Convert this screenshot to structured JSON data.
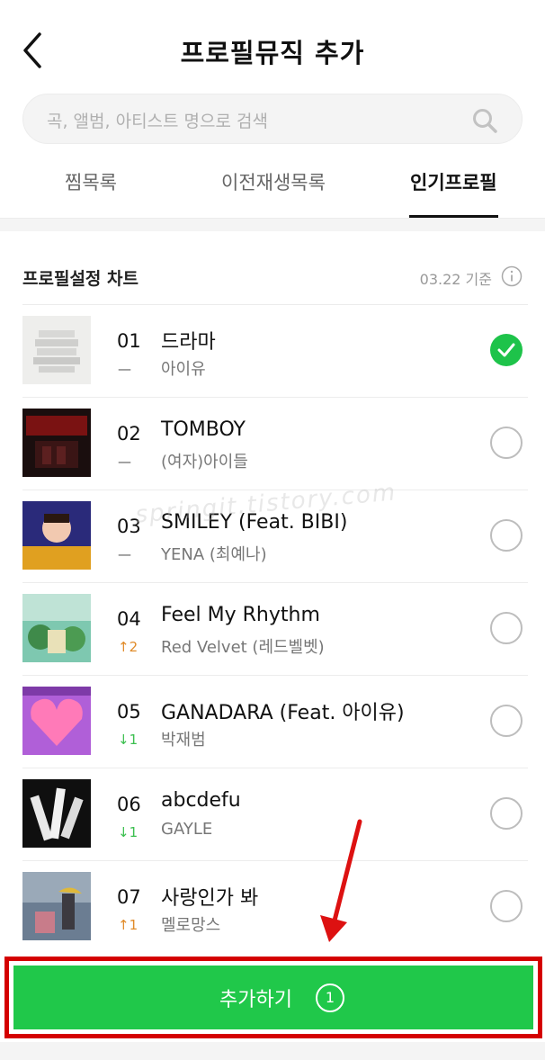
{
  "header": {
    "title": "프로필뮤직 추가",
    "back_icon": "chevron-left-icon"
  },
  "search": {
    "placeholder": "곡, 앨범, 아티스트 명으로 검색",
    "icon": "search-icon"
  },
  "tabs": [
    {
      "label": "찜목록",
      "active": false
    },
    {
      "label": "이전재생목록",
      "active": false
    },
    {
      "label": "인기프로필",
      "active": true
    }
  ],
  "section": {
    "title": "프로필설정 차트",
    "date": "03.22 기준",
    "info_icon": "info-icon"
  },
  "chart": [
    {
      "rank": "01",
      "change": "—",
      "change_type": "same",
      "title": "드라마",
      "artist": "아이유",
      "selected": true
    },
    {
      "rank": "02",
      "change": "—",
      "change_type": "same",
      "title": "TOMBOY",
      "artist": "(여자)아이들",
      "selected": false
    },
    {
      "rank": "03",
      "change": "—",
      "change_type": "same",
      "title": "SMILEY (Feat. BIBI)",
      "artist": "YENA (최예나)",
      "selected": false
    },
    {
      "rank": "04",
      "change": "↑2",
      "change_type": "up",
      "title": "Feel My Rhythm",
      "artist": "Red Velvet (레드벨벳)",
      "selected": false
    },
    {
      "rank": "05",
      "change": "↓1",
      "change_type": "down",
      "title": "GANADARA (Feat. 아이유)",
      "artist": "박재범",
      "selected": false
    },
    {
      "rank": "06",
      "change": "↓1",
      "change_type": "down",
      "title": "abcdefu",
      "artist": "GAYLE",
      "selected": false
    },
    {
      "rank": "07",
      "change": "↑1",
      "change_type": "up",
      "title": "사랑인가 봐",
      "artist": "멜로망스",
      "selected": false
    }
  ],
  "watermark": "springit.tistory.com",
  "cta": {
    "label": "추가하기",
    "count": "1"
  },
  "colors": {
    "accent_green": "#20c84a",
    "highlight_red": "#d40000",
    "up": "#e08b29",
    "down": "#3bbf4f"
  }
}
